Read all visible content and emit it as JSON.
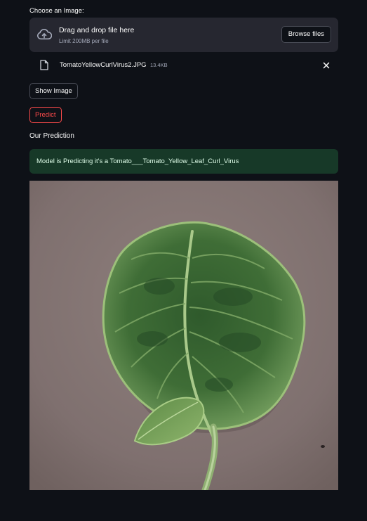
{
  "uploader": {
    "label": "Choose an Image:",
    "drop_title": "Drag and drop file here",
    "limit_text": "Limit 200MB per file",
    "browse_label": "Browse files"
  },
  "file": {
    "name": "TomatoYellowCurlVirus2.JPG",
    "size": "13.4KB"
  },
  "buttons": {
    "show_image": "Show Image",
    "predict": "Predict"
  },
  "prediction": {
    "heading": "Our Prediction",
    "message": "Model is Predicting it's a Tomato___Tomato_Yellow_Leaf_Curl_Virus"
  },
  "icons": {
    "upload": "cloud-upload-icon",
    "file": "file-icon",
    "remove": "close-icon"
  },
  "colors": {
    "background": "#0e1117",
    "dropzone": "#262730",
    "accent": "#ff4b4b",
    "success_bg": "#173928",
    "success_text": "#dffde9"
  }
}
